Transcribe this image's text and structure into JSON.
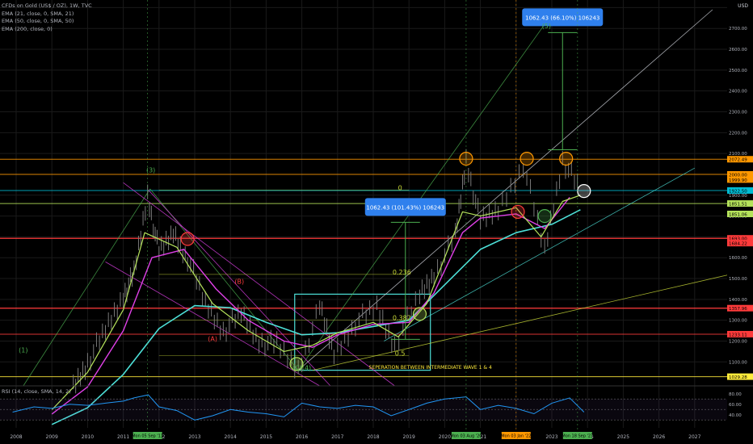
{
  "legend": {
    "symbol": "CFDs on Gold (US$ / OZ), 1W, TVC",
    "ema1": "EMA (21, close, 0, SMA, 21)",
    "ema2": "EMA (50, close, 0, SMA, 50)",
    "ema3": "EMA (200, close, 0)",
    "rsi": "RSI (14, close, SMA, 14, 2)"
  },
  "currency": "USD",
  "colors": {
    "bg": "#000000",
    "grid": "#1a1a1a",
    "candle": "#7a7a7a",
    "ema21": "#b5e35b",
    "ema50": "#e040e8",
    "ema200": "#4de0d8",
    "orange": "#ff9800",
    "red": "#ff3b3b",
    "green": "#4caf50",
    "yellow": "#ffeb3b",
    "cyan": "#4de0d8",
    "blue_label": "#2f80ed",
    "rsi": "#2196f3"
  },
  "chart_data": {
    "type": "line",
    "x_axis": {
      "type": "date",
      "ticks": [
        "2008",
        "2009",
        "2010",
        "2011",
        "2012",
        "2013",
        "2014",
        "2015",
        "2016",
        "2017",
        "2018",
        "2019",
        "2020",
        "2021",
        "2022",
        "2023",
        "2024",
        "2025",
        "2026",
        "2027",
        "2028"
      ],
      "highlight_labels": [
        "Mon 05 Sep '11",
        "Mon 03 Aug '20",
        "Mon 03 Jan '22",
        "Mon 18 Sep '23"
      ]
    },
    "y_axis": {
      "scale": "linear",
      "ylim": [
        985,
        2790
      ],
      "tick_values": [
        1100,
        1200,
        1300,
        1400,
        1500,
        1600,
        1700,
        1800,
        1900,
        2000,
        2100,
        2200,
        2300,
        2400,
        2500,
        2600,
        2700,
        2800
      ],
      "tick_labels": [
        "1100.00",
        "1200.00",
        "1300.00",
        "1400.00",
        "1500.00",
        "1600.00",
        "1700.00",
        "1800.00",
        "1900.00",
        "2000.00",
        "2100.00",
        "2200.00",
        "2300.00",
        "2400.00",
        "2500.00",
        "2600.00",
        "2700.00",
        "2800.00"
      ]
    },
    "price_tags": [
      {
        "label": "2072.49",
        "value": 2072.49,
        "color": "#ff9800"
      },
      {
        "label": "2000.00",
        "value": 2000.0,
        "color": "#ff9800"
      },
      {
        "label": "1999.90",
        "value": 1975.0,
        "color": "#ff9800"
      },
      {
        "label": "1922.50",
        "value": 1922.5,
        "color": "#00bcd4"
      },
      {
        "label": "1851.51",
        "value": 1860.0,
        "color": "#b5e35b"
      },
      {
        "label": "1851.06",
        "value": 1810.0,
        "color": "#b5e35b"
      },
      {
        "label": "1693.00",
        "value": 1693.0,
        "color": "#ff3b3b"
      },
      {
        "label": "1684.22",
        "value": 1670.0,
        "color": "#ff3b3b"
      },
      {
        "label": "1357.96",
        "value": 1357.96,
        "color": "#ff3b3b"
      },
      {
        "label": "1233.11",
        "value": 1233.11,
        "color": "#ff3b3b"
      },
      {
        "label": "1029.28",
        "value": 1029.28,
        "color": "#ffeb3b"
      }
    ],
    "price_levels": [
      {
        "value": 2072.49,
        "color": "#ff9800",
        "width": 1
      },
      {
        "value": 2000.0,
        "color": "#ff9800",
        "width": 1
      },
      {
        "value": 1922.5,
        "color": "#00bcd4",
        "width": 1
      },
      {
        "value": 1860.0,
        "color": "#b5e35b",
        "width": 1
      },
      {
        "value": 1693.0,
        "color": "#ff3b3b",
        "width": 1.5
      },
      {
        "value": 1357.96,
        "color": "#ff3b3b",
        "width": 1.5
      },
      {
        "value": 1233.11,
        "color": "#ff3b3b",
        "width": 1
      },
      {
        "value": 1029.28,
        "color": "#ffeb3b",
        "width": 1
      }
    ],
    "series": [
      {
        "name": "EMA 21",
        "x": [
          2009,
          2010,
          2011,
          2011.6,
          2012.5,
          2013.5,
          2014.5,
          2015.5,
          2016.3,
          2017,
          2018,
          2018.7,
          2019.5,
          2020.5,
          2021,
          2022,
          2022.7,
          2023.3,
          2023.8
        ],
        "values": [
          870,
          1050,
          1350,
          1720,
          1650,
          1380,
          1250,
          1150,
          1180,
          1240,
          1290,
          1220,
          1380,
          1820,
          1800,
          1840,
          1700,
          1870,
          1900
        ]
      },
      {
        "name": "EMA 50",
        "x": [
          2009,
          2010,
          2011,
          2011.8,
          2012.7,
          2013.6,
          2014.5,
          2015.5,
          2016.3,
          2017,
          2018,
          2019,
          2019.7,
          2020.5,
          2021,
          2022,
          2022.8,
          2023.5
        ],
        "values": [
          850,
          980,
          1250,
          1600,
          1640,
          1450,
          1300,
          1200,
          1170,
          1230,
          1280,
          1290,
          1430,
          1720,
          1790,
          1810,
          1740,
          1890
        ]
      },
      {
        "name": "EMA 200",
        "x": [
          2009,
          2010,
          2011,
          2012,
          2013,
          2014,
          2015,
          2016,
          2017,
          2018,
          2019,
          2020,
          2021,
          2022,
          2023,
          2023.8
        ],
        "values": [
          800,
          880,
          1040,
          1260,
          1370,
          1360,
          1290,
          1230,
          1240,
          1270,
          1300,
          1470,
          1640,
          1720,
          1760,
          1830
        ]
      },
      {
        "name": "Price",
        "x": [
          2009.6,
          2010,
          2010.5,
          2011,
          2011.3,
          2011.68,
          2012,
          2012.4,
          2012.8,
          2013.3,
          2013.8,
          2014.3,
          2014.8,
          2015.3,
          2015.9,
          2016.5,
          2016.9,
          2017.5,
          2018.1,
          2018.6,
          2019.3,
          2019.7,
          2020.3,
          2020.6,
          2021,
          2021.5,
          2022.2,
          2022.8,
          2023.3,
          2023.8
        ],
        "values": [
          980,
          1100,
          1250,
          1420,
          1520,
          1900,
          1620,
          1720,
          1600,
          1380,
          1250,
          1330,
          1200,
          1180,
          1060,
          1360,
          1140,
          1290,
          1360,
          1180,
          1420,
          1520,
          1700,
          2070,
          1770,
          1830,
          2050,
          1630,
          2070,
          1920
        ]
      }
    ],
    "annotations": [
      {
        "text": "(1)",
        "x": 2008.2,
        "y": 1145,
        "color": "#4caf50"
      },
      {
        "text": "(3)",
        "x": 2011.77,
        "y": 2010,
        "color": "#4caf50"
      },
      {
        "text": "(5)",
        "x": 2022.85,
        "y": 2700,
        "color": "#4caf50"
      },
      {
        "text": "(C)(4)",
        "x": 2016.0,
        "y": 1060,
        "color": "#4caf50"
      },
      {
        "text": "(A)",
        "x": 2013.5,
        "y": 1200,
        "color": "#ff3b3b"
      },
      {
        "text": "(B)",
        "x": 2014.25,
        "y": 1475,
        "color": "#ff3b3b"
      },
      {
        "text": "0",
        "x": 2018.75,
        "y": 1925,
        "color": "#cddc39"
      },
      {
        "text": "0.236",
        "x": 2018.8,
        "y": 1520,
        "color": "#cddc39"
      },
      {
        "text": "0.382",
        "x": 2018.8,
        "y": 1300,
        "color": "#cddc39"
      },
      {
        "text": "0.5",
        "x": 2018.75,
        "y": 1130,
        "color": "#cddc39"
      },
      {
        "text": "SEPERATION BETWEEN INTERMEDIATE WAVE 1 & 4",
        "x": 2019.6,
        "y": 1067,
        "color": "#ffeb3b"
      }
    ],
    "measure_boxes": [
      {
        "label": "1062.43 (101.43%) 106243",
        "x": 2018.9,
        "y_top": 1770,
        "y_bottom": 708
      },
      {
        "label": "1062.43 (66.10%) 106243",
        "x": 2023.3,
        "y_top": 2680,
        "y_bottom": 1618
      }
    ],
    "rsi_axis": {
      "ylim": [
        15,
        95
      ],
      "tick_values": [
        80,
        60,
        40
      ],
      "tick_labels": [
        "80.00",
        "60.00",
        "40.00"
      ],
      "levels": [
        70,
        50,
        30
      ]
    },
    "rsi": {
      "name": "RSI",
      "x": [
        2007.9,
        2008.5,
        2009,
        2009.5,
        2010,
        2010.5,
        2011,
        2011.3,
        2011.7,
        2012,
        2012.5,
        2013,
        2013.5,
        2014,
        2014.5,
        2015,
        2015.5,
        2016,
        2016.5,
        2017,
        2017.5,
        2018,
        2018.5,
        2019,
        2019.5,
        2020,
        2020.6,
        2021,
        2021.5,
        2022,
        2022.5,
        2023,
        2023.5,
        2023.9
      ],
      "values": [
        45,
        55,
        52,
        60,
        58,
        62,
        66,
        72,
        78,
        55,
        48,
        30,
        38,
        50,
        45,
        42,
        36,
        62,
        55,
        52,
        58,
        55,
        38,
        50,
        62,
        70,
        74,
        50,
        58,
        52,
        42,
        62,
        72,
        45
      ]
    }
  }
}
